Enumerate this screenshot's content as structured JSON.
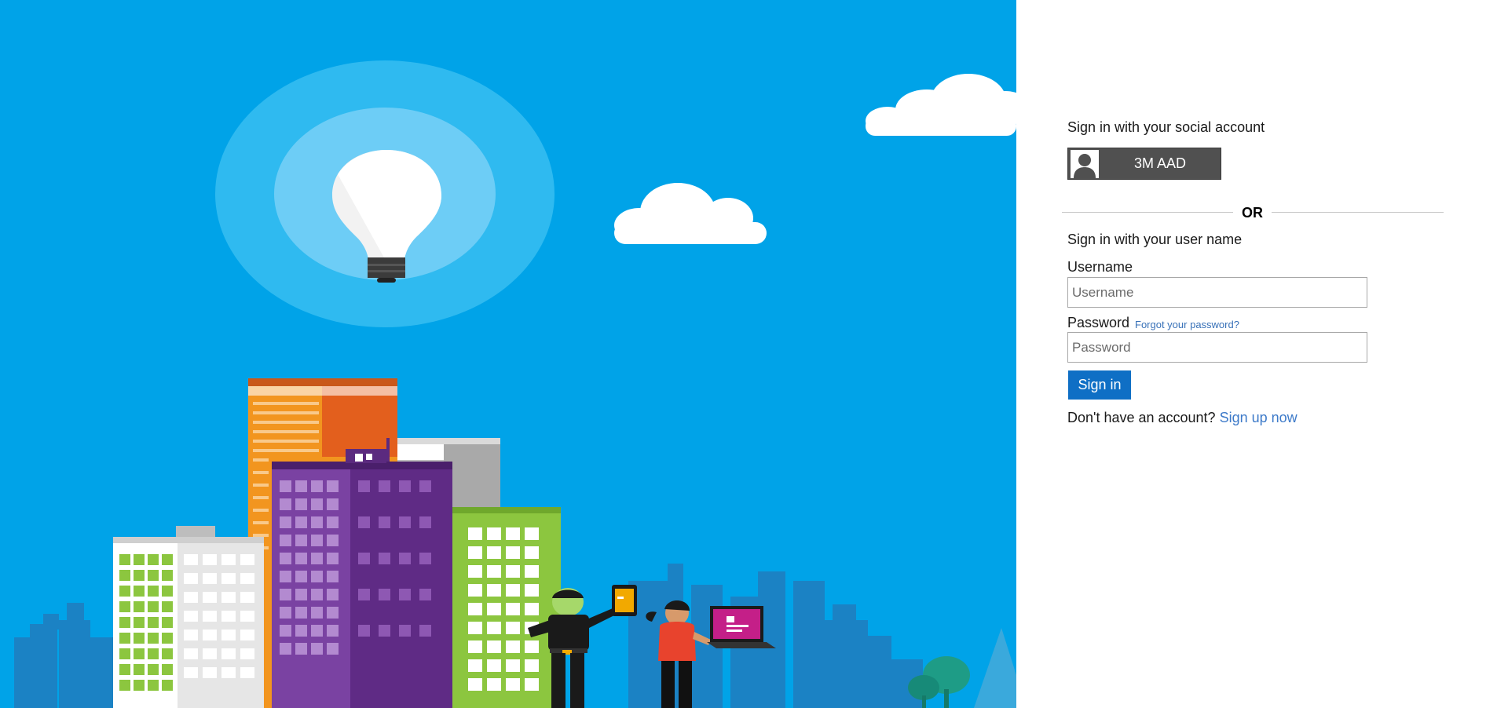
{
  "hero": {
    "illustration": "city-skyline-lightbulb"
  },
  "social": {
    "heading": "Sign in with your social account",
    "provider_label": "3M AAD",
    "provider_icon": "user-icon"
  },
  "divider": {
    "label": "OR"
  },
  "local": {
    "heading": "Sign in with your user name",
    "username_label": "Username",
    "username_placeholder": "Username",
    "username_value": "",
    "password_label": "Password",
    "password_placeholder": "Password",
    "password_value": "",
    "forgot_link": "Forgot your password?",
    "signin_button": "Sign in"
  },
  "signup": {
    "prompt": "Don't have an account?",
    "link": "Sign up now"
  },
  "colors": {
    "hero_background": "#00a3e8",
    "primary_button": "#0f6fc5",
    "link": "#3d7ac9",
    "social_button": "#505050"
  }
}
